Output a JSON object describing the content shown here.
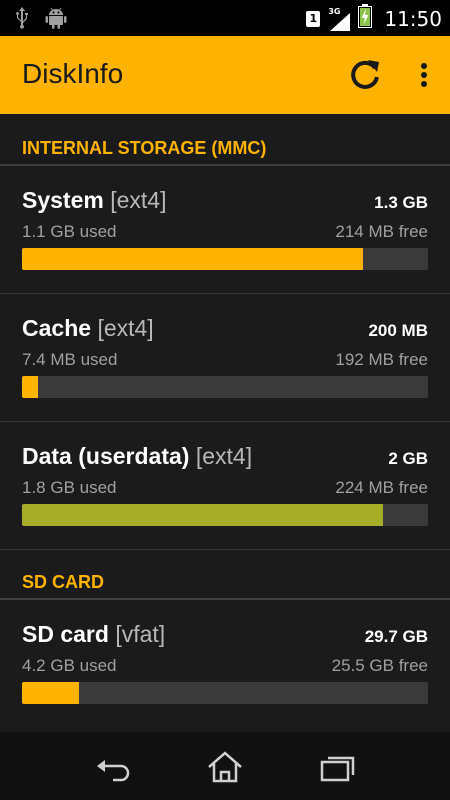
{
  "status_bar": {
    "time": "11:50",
    "sim": "1",
    "network": "3G",
    "icons": [
      "usb-icon",
      "android-debug-icon",
      "sim-icon",
      "signal-icon",
      "battery-charging-icon"
    ]
  },
  "app_bar": {
    "title": "DiskInfo",
    "actions": [
      "refresh-icon",
      "overflow-menu-icon"
    ],
    "color": "#ffb300"
  },
  "sections": [
    {
      "title": "INTERNAL STORAGE (MMC)",
      "items": [
        {
          "name": "System",
          "fs": "[ext4]",
          "total": "1.3 GB",
          "used": "1.1 GB used",
          "free": "214 MB free",
          "fill": 0.84,
          "color": "#ffb300"
        },
        {
          "name": "Cache",
          "fs": "[ext4]",
          "total": "200 MB",
          "used": "7.4 MB used",
          "free": "192 MB free",
          "fill": 0.04,
          "color": "#ffb300"
        },
        {
          "name": "Data (userdata)",
          "fs": "[ext4]",
          "total": "2 GB",
          "used": "1.8 GB used",
          "free": "224 MB free",
          "fill": 0.89,
          "color": "#a6ad27"
        }
      ]
    },
    {
      "title": "SD CARD",
      "items": [
        {
          "name": "SD card",
          "fs": "[vfat]",
          "total": "29.7 GB",
          "used": "4.2 GB used",
          "free": "25.5 GB free",
          "fill": 0.14,
          "color": "#ffb300"
        }
      ]
    }
  ],
  "nav_bar": {
    "buttons": [
      "back-icon",
      "home-icon",
      "recent-apps-icon"
    ]
  }
}
